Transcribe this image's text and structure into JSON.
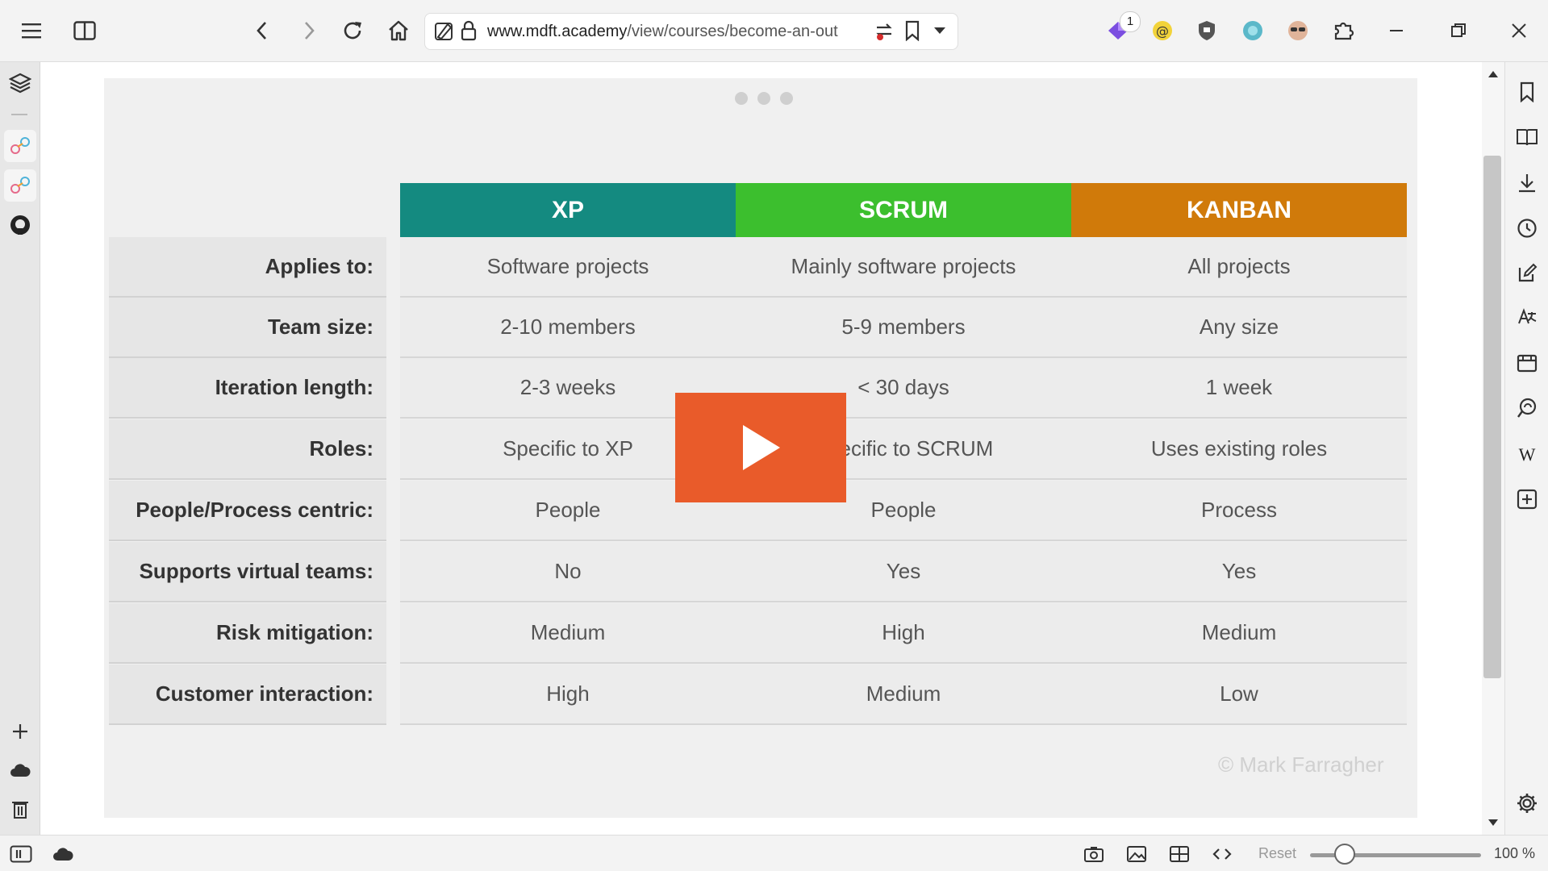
{
  "browser": {
    "url_host": "www.mdft.academy",
    "url_path": "/view/courses/become-an-out",
    "extension_badge": "1",
    "icons": [
      "menu-icon",
      "split-view-icon",
      "back-icon",
      "forward-icon",
      "reload-icon",
      "home-icon",
      "tracking-off-icon",
      "lock-icon",
      "reader-icon",
      "bookmark-icon",
      "dropdown-icon",
      "extension-icon",
      "minimize-icon",
      "restore-icon",
      "close-icon"
    ]
  },
  "status_bar": {
    "zoom_reset": "Reset",
    "zoom_level": "100 %",
    "zoom_value_percent": 100
  },
  "slide": {
    "headers": [
      {
        "label": "XP",
        "color": "#148a80"
      },
      {
        "label": "SCRUM",
        "color": "#3cbf2e"
      },
      {
        "label": "KANBAN",
        "color": "#d07a0a"
      }
    ],
    "rows": [
      {
        "label": "Applies to:",
        "xp": "Software projects",
        "scrum": "Mainly software projects",
        "kanban": "All projects"
      },
      {
        "label": "Team size:",
        "xp": "2-10 members",
        "scrum": "5-9 members",
        "kanban": "Any size"
      },
      {
        "label": "Iteration length:",
        "xp": "2-3 weeks",
        "scrum": "< 30 days",
        "kanban": "1 week"
      },
      {
        "label": "Roles:",
        "xp": "Specific to XP",
        "scrum": "Specific to SCRUM",
        "kanban": "Uses existing roles"
      },
      {
        "label": "People/Process centric:",
        "xp": "People",
        "scrum": "People",
        "kanban": "Process"
      },
      {
        "label": "Supports virtual teams:",
        "xp": "No",
        "scrum": "Yes",
        "kanban": "Yes"
      },
      {
        "label": "Risk mitigation:",
        "xp": "Medium",
        "scrum": "High",
        "kanban": "Medium"
      },
      {
        "label": "Customer interaction:",
        "xp": "High",
        "scrum": "Medium",
        "kanban": "Low"
      }
    ],
    "copyright": "© Mark Farragher"
  },
  "colors": {
    "play_button": "#e95b2a"
  }
}
